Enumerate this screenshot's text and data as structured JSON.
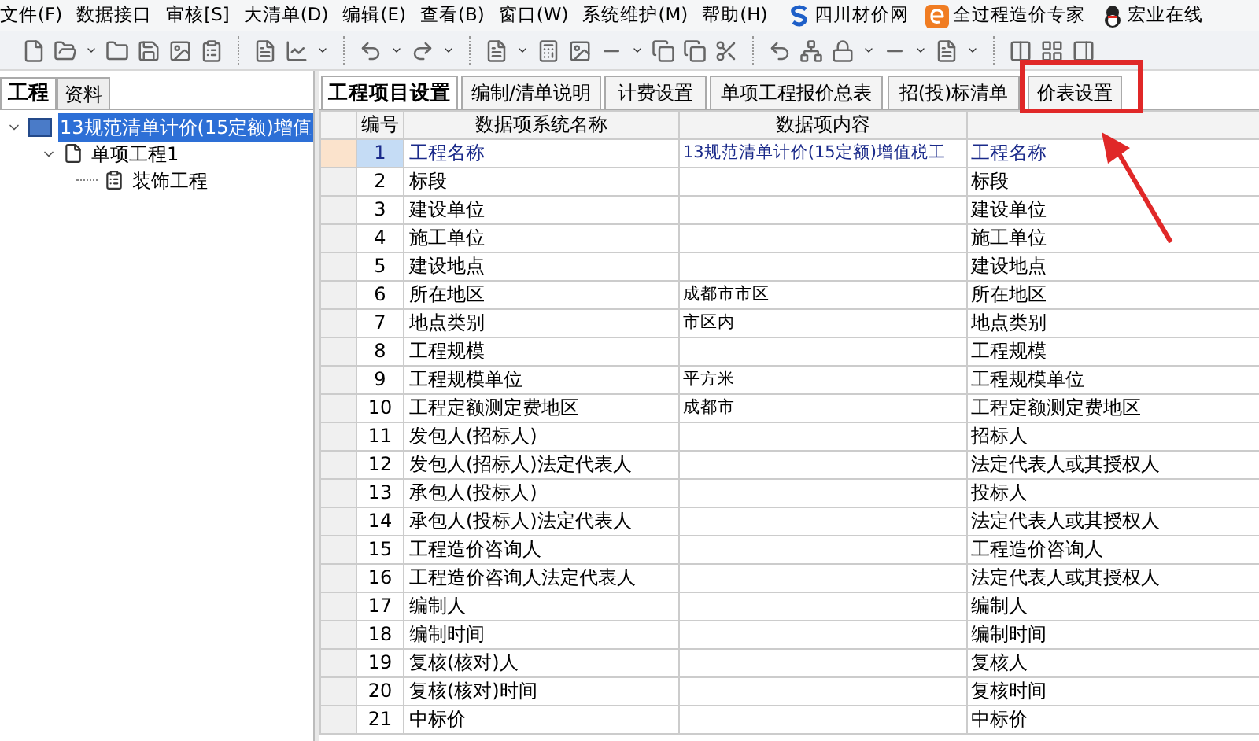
{
  "menu": [
    "文件(F)",
    "数据接口",
    "审核[S]",
    "大清单(D)",
    "编辑(E)",
    "查看(B)",
    "窗口(W)",
    "系统维护(M)",
    "帮助(H)"
  ],
  "menu_links": [
    {
      "label": "四川材价网",
      "kind": "s"
    },
    {
      "label": "全过程造价专家",
      "kind": "e"
    },
    {
      "label": "宏业在线",
      "kind": "penguin"
    }
  ],
  "left_tabs": [
    {
      "label": "工程",
      "selected": true
    },
    {
      "label": "资料",
      "selected": false
    }
  ],
  "tree": [
    {
      "label": "13规范清单计价(15定额)增值",
      "expanded": true,
      "selected": true,
      "kind": "project",
      "children": [
        {
          "label": "单项工程1",
          "expanded": true,
          "selected": false,
          "kind": "item",
          "children": [
            {
              "label": "装饰工程",
              "selected": false,
              "kind": "unit"
            }
          ]
        }
      ]
    }
  ],
  "tabs": [
    {
      "label": "工程项目设置",
      "selected": true
    },
    {
      "label": "编制/清单说明",
      "selected": false
    },
    {
      "label": "计费设置",
      "selected": false
    },
    {
      "label": "单项工程报价总表",
      "selected": false
    },
    {
      "label": "招(投)标清单",
      "selected": false
    },
    {
      "label": "价表设置",
      "selected": false
    }
  ],
  "table": {
    "columns": [
      "编号",
      "数据项系统名称",
      "数据项内容"
    ],
    "rows": [
      {
        "number": "1",
        "name": "工程名称",
        "content": "13规范清单计价(15定额)增值税工",
        "column_4": "工程名称",
        "selected": true
      },
      {
        "number": "2",
        "name": "标段",
        "column_4": "标段",
        "selected": false
      },
      {
        "number": "3",
        "name": "建设单位",
        "column_4": "建设单位",
        "selected": false
      },
      {
        "number": "4",
        "name": "施工单位",
        "column_4": "施工单位",
        "selected": false
      },
      {
        "number": "5",
        "name": "建设地点",
        "column_4": "建设地点",
        "selected": false
      },
      {
        "number": "6",
        "name": "所在地区",
        "content": "成都市市区",
        "column_4": "所在地区",
        "selected": false
      },
      {
        "number": "7",
        "name": "地点类别",
        "content": "市区内",
        "column_4": "地点类别",
        "selected": false
      },
      {
        "number": "8",
        "name": "工程规模",
        "column_4": "工程规模",
        "selected": false
      },
      {
        "number": "9",
        "name": "工程规模单位",
        "content": "平方米",
        "column_4": "工程规模单位",
        "selected": false
      },
      {
        "number": "10",
        "name": "工程定额测定费地区",
        "content": "成都市",
        "column_4": "工程定额测定费地区",
        "selected": false
      },
      {
        "number": "11",
        "name": "发包人(招标人)",
        "column_4": "招标人",
        "selected": false
      },
      {
        "number": "12",
        "name": "发包人(招标人)法定代表人",
        "column_4": "法定代表人或其授权人",
        "selected": false
      },
      {
        "number": "13",
        "name": "承包人(投标人)",
        "column_4": "投标人",
        "selected": false
      },
      {
        "number": "14",
        "name": "承包人(投标人)法定代表人",
        "column_4": "法定代表人或其授权人",
        "selected": false
      },
      {
        "number": "15",
        "name": "工程造价咨询人",
        "column_4": "工程造价咨询人",
        "selected": false
      },
      {
        "number": "16",
        "name": "工程造价咨询人法定代表人",
        "column_4": "法定代表人或其授权人",
        "selected": false
      },
      {
        "number": "17",
        "name": "编制人",
        "column_4": "编制人",
        "selected": false
      },
      {
        "number": "18",
        "name": "编制时间",
        "column_4": "编制时间",
        "selected": false
      },
      {
        "number": "19",
        "name": "复核(核对)人",
        "column_4": "复核人",
        "selected": false
      },
      {
        "number": "20",
        "name": "复核(核对)时间",
        "column_4": "复核时间",
        "selected": false
      },
      {
        "number": "21",
        "name": "中标价",
        "column_4": "中标价",
        "selected": false
      }
    ]
  }
}
